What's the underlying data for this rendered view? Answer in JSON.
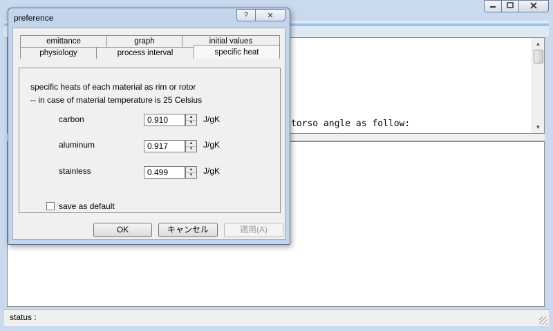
{
  "main_window": {
    "title": "",
    "log_line": "torso angle as follow:",
    "status_label": "status :"
  },
  "dialog": {
    "title": "preference",
    "help_glyph": "?",
    "close_glyph": "✕",
    "tabs_row1": [
      "emittance",
      "graph",
      "initial values"
    ],
    "tabs_row2": [
      "physiology",
      "process interval",
      "specific heat"
    ],
    "active_tab": "specific heat",
    "description_line1": "specific heats of each material as rim or rotor",
    "description_line2": "-- in case of material temperature is 25 Celsius",
    "materials": [
      {
        "name": "carbon",
        "value": "0.910",
        "unit": "J/gK"
      },
      {
        "name": "aluminum",
        "value": "0.917",
        "unit": "J/gK"
      },
      {
        "name": "stainless",
        "value": "0.499",
        "unit": "J/gK"
      }
    ],
    "save_default_label": "save as default",
    "save_default_checked": false,
    "ok_label": "OK",
    "cancel_label": "キャンセル",
    "apply_label": "適用(A)"
  },
  "icons": {
    "minimize": "minimize-icon",
    "maximize": "maximize-icon",
    "close": "close-icon",
    "help": "help-icon",
    "spin_up": "spin-up-icon",
    "spin_down": "spin-down-icon",
    "resize_grip": "resize-grip-icon"
  }
}
